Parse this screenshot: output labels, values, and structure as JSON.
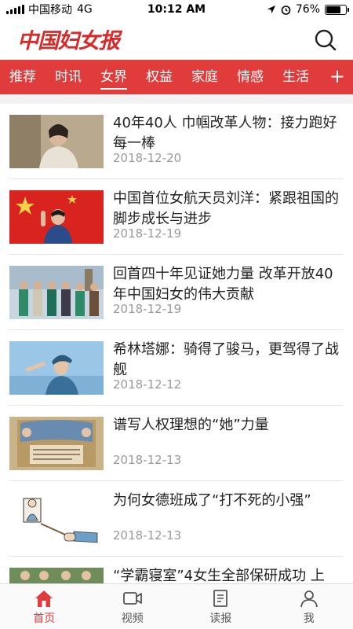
{
  "status_bar": {
    "carrier": "中国移动",
    "network": "4G",
    "time": "10:12 AM",
    "battery": "76%",
    "battery_level": 0.76
  },
  "header": {
    "logo": "中国妇女报"
  },
  "nav": {
    "tabs": [
      "推荐",
      "时讯",
      "女界",
      "权益",
      "家庭",
      "情感",
      "生活"
    ],
    "active_index": 2,
    "add_label": "+"
  },
  "articles": [
    {
      "title": "40年40人 巾帼改革人物：接力跑好每一棒",
      "date": "2018-12-20"
    },
    {
      "title": "中国首位女航天员刘洋：紧跟祖国的脚步成长与进步",
      "date": "2018-12-19"
    },
    {
      "title": "回首四十年见证她力量 改革开放40年中国妇女的伟大贡献",
      "date": "2018-12-19"
    },
    {
      "title": "希林塔娜：骑得了骏马，更驾得了战舰",
      "date": "2018-12-12"
    },
    {
      "title": "谱写人权理想的“她”力量",
      "date": "2018-12-13"
    },
    {
      "title": "为何女德班成了“打不死的小强”",
      "date": "2018-12-13"
    },
    {
      "title": "“学霸寝室”4女生全部保研成功 上",
      "date": ""
    }
  ],
  "tabbar": {
    "items": [
      {
        "label": "首页",
        "icon": "home-icon"
      },
      {
        "label": "视频",
        "icon": "video-icon"
      },
      {
        "label": "读报",
        "icon": "newspaper-icon"
      },
      {
        "label": "我",
        "icon": "user-icon"
      }
    ],
    "active_index": 0
  },
  "colors": {
    "brand_red": "#e03c3c",
    "logo_red": "#d52b2b",
    "date_gray": "#9a9a9a"
  }
}
